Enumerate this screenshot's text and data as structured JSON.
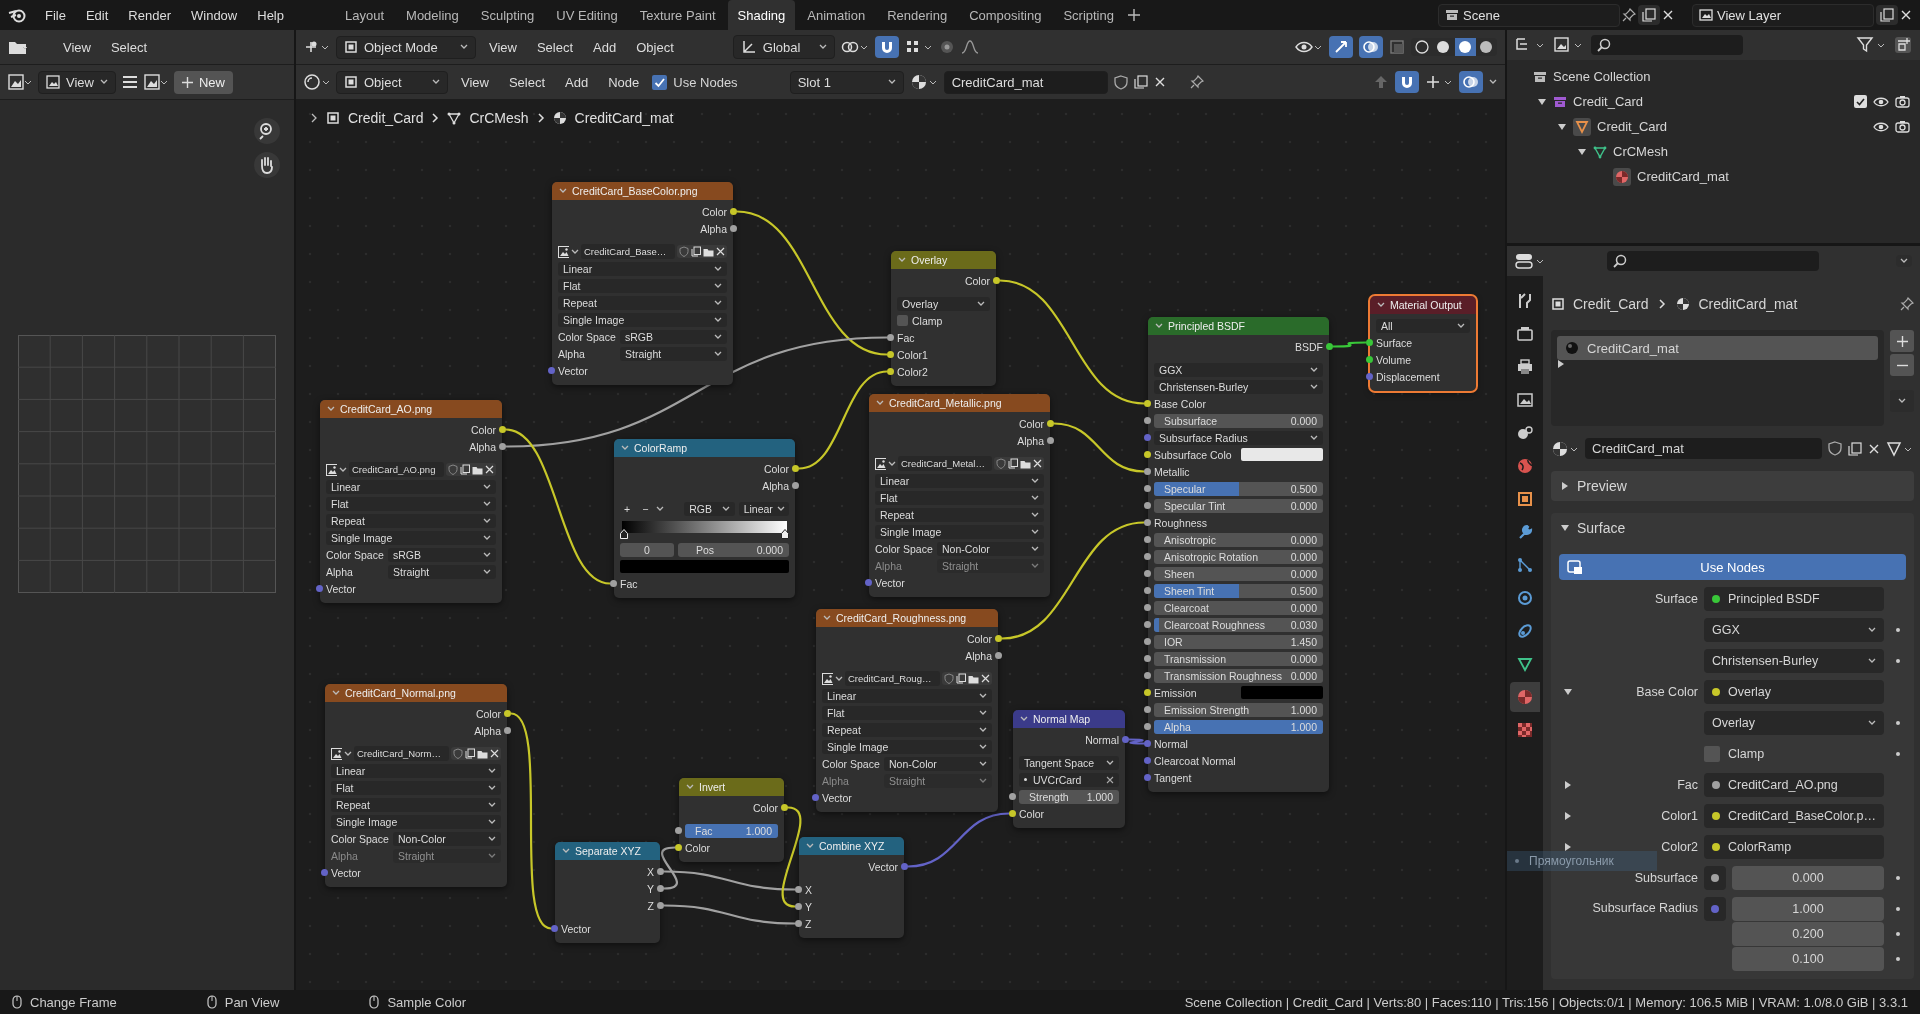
{
  "menu": [
    "File",
    "Edit",
    "Render",
    "Window",
    "Help"
  ],
  "workspaces": [
    {
      "label": "Layout",
      "selected": false
    },
    {
      "label": "Modeling",
      "selected": false
    },
    {
      "label": "Sculpting",
      "selected": false
    },
    {
      "label": "UV Editing",
      "selected": false
    },
    {
      "label": "Texture Paint",
      "selected": false
    },
    {
      "label": "Shading",
      "selected": true
    },
    {
      "label": "Animation",
      "selected": false
    },
    {
      "label": "Rendering",
      "selected": false
    },
    {
      "label": "Compositing",
      "selected": false
    },
    {
      "label": "Scripting",
      "selected": false
    }
  ],
  "scene": "Scene",
  "view_layer": "View Layer",
  "file_browser_header": {
    "menus": [
      "View",
      "Select"
    ]
  },
  "image_editor_header": {
    "view": "View",
    "new_button": "New"
  },
  "viewport_header": {
    "mode": "Object Mode",
    "menus": [
      "View",
      "Select",
      "Add",
      "Object"
    ],
    "orientation": "Global"
  },
  "node_header": {
    "type": "Object",
    "menus": [
      "View",
      "Select",
      "Add",
      "Node"
    ],
    "use_nodes": {
      "label": "Use Nodes",
      "checked": true
    },
    "slot": "Slot 1",
    "material": "CreditCard_mat"
  },
  "breadcrumbs": [
    {
      "label": "Credit_Card",
      "kind": "object"
    },
    {
      "label": "CrCMesh",
      "kind": "mesh"
    },
    {
      "label": "CreditCard_mat",
      "kind": "material"
    }
  ],
  "nodes": [
    {
      "title": "CreditCard_BaseColor.png",
      "kind": "texture",
      "selected": false,
      "rows": [
        {
          "kind": "output",
          "label": "Color",
          "socket": {
            "kind": "color"
          }
        },
        {
          "kind": "output",
          "label": "Alpha",
          "socket": {
            "kind": "float"
          }
        },
        {
          "kind": "image",
          "value": "CreditCard_Base…"
        },
        {
          "kind": "select",
          "value": "Linear"
        },
        {
          "kind": "select",
          "value": "Flat"
        },
        {
          "kind": "select",
          "value": "Repeat"
        },
        {
          "kind": "select",
          "value": "Single Image"
        },
        {
          "kind": "field",
          "label": "Color Space",
          "value": "sRGB",
          "disabled": false
        },
        {
          "kind": "field",
          "label": "Alpha",
          "value": "Straight",
          "disabled": false
        },
        {
          "kind": "input",
          "label": "Vector",
          "socket": {
            "kind": "vector"
          }
        }
      ]
    },
    {
      "title": "Overlay",
      "kind": "color",
      "selected": false,
      "rows": [
        {
          "kind": "output",
          "label": "Color",
          "socket": {
            "kind": "color"
          }
        },
        {
          "kind": "select",
          "value": "Overlay"
        },
        {
          "kind": "checkbox",
          "label": "Clamp",
          "checked": false
        },
        {
          "kind": "input",
          "label": "Fac",
          "socket": {
            "kind": "float"
          }
        },
        {
          "kind": "input",
          "label": "Color1",
          "socket": {
            "kind": "color"
          }
        },
        {
          "kind": "input",
          "label": "Color2",
          "socket": {
            "kind": "color"
          }
        }
      ]
    },
    {
      "title": "Principled BSDF",
      "kind": "shader",
      "selected": false,
      "rows": [
        {
          "kind": "output",
          "label": "BSDF",
          "socket": {
            "kind": "shader"
          }
        },
        {
          "kind": "select",
          "value": "GGX"
        },
        {
          "kind": "select",
          "value": "Christensen-Burley"
        },
        {
          "kind": "input",
          "label": "Base Color",
          "socket": {
            "kind": "color"
          }
        },
        {
          "kind": "slider",
          "label": "Subsurface",
          "value": "0.000",
          "level": 0,
          "socket": {
            "kind": "float"
          }
        },
        {
          "kind": "select",
          "value": "Subsurface Radius",
          "socket": {
            "kind": "vector"
          }
        },
        {
          "kind": "color",
          "label": "Subsurface Colo",
          "color": "#e8e8e8",
          "socket": {
            "kind": "color"
          }
        },
        {
          "kind": "input",
          "label": "Metallic",
          "socket": {
            "kind": "float"
          }
        },
        {
          "kind": "slider",
          "label": "Specular",
          "value": "0.500",
          "level": 0.5,
          "socket": {
            "kind": "float"
          }
        },
        {
          "kind": "slider",
          "label": "Specular Tint",
          "value": "0.000",
          "level": 0,
          "socket": {
            "kind": "float"
          }
        },
        {
          "kind": "input",
          "label": "Roughness",
          "socket": {
            "kind": "float"
          }
        },
        {
          "kind": "slider",
          "label": "Anisotropic",
          "value": "0.000",
          "level": 0,
          "socket": {
            "kind": "float"
          }
        },
        {
          "kind": "slider",
          "label": "Anisotropic Rotation",
          "value": "0.000",
          "level": 0,
          "socket": {
            "kind": "float"
          }
        },
        {
          "kind": "slider",
          "label": "Sheen",
          "value": "0.000",
          "level": 0,
          "socket": {
            "kind": "float"
          }
        },
        {
          "kind": "slider",
          "label": "Sheen Tint",
          "value": "0.500",
          "level": 0.5,
          "socket": {
            "kind": "float"
          }
        },
        {
          "kind": "slider",
          "label": "Clearcoat",
          "value": "0.000",
          "level": 0,
          "socket": {
            "kind": "float"
          }
        },
        {
          "kind": "slider",
          "label": "Clearcoat Roughness",
          "value": "0.030",
          "level": 0.03,
          "socket": {
            "kind": "float"
          }
        },
        {
          "kind": "slider",
          "label": "IOR",
          "value": "1.450",
          "level": 0,
          "socket": {
            "kind": "float"
          }
        },
        {
          "kind": "slider",
          "label": "Transmission",
          "value": "0.000",
          "level": 0,
          "socket": {
            "kind": "float"
          }
        },
        {
          "kind": "slider",
          "label": "Transmission Roughness",
          "value": "0.000",
          "level": 0,
          "socket": {
            "kind": "float"
          }
        },
        {
          "kind": "color",
          "label": "Emission",
          "color": "#000000",
          "socket": {
            "kind": "color"
          }
        },
        {
          "kind": "slider",
          "label": "Emission Strength",
          "value": "1.000",
          "level": 0,
          "socket": {
            "kind": "float"
          }
        },
        {
          "kind": "slider",
          "label": "Alpha",
          "value": "1.000",
          "level": 1,
          "socket": {
            "kind": "float"
          }
        },
        {
          "kind": "input",
          "label": "Normal",
          "socket": {
            "kind": "vector"
          }
        },
        {
          "kind": "input",
          "label": "Clearcoat Normal",
          "socket": {
            "kind": "vector"
          }
        },
        {
          "kind": "input",
          "label": "Tangent",
          "socket": {
            "kind": "vector"
          }
        }
      ]
    },
    {
      "title": "Material Output",
      "kind": "output",
      "selected": true,
      "rows": [
        {
          "kind": "select",
          "value": "All"
        },
        {
          "kind": "input",
          "label": "Surface",
          "socket": {
            "kind": "shader"
          }
        },
        {
          "kind": "input",
          "label": "Volume",
          "socket": {
            "kind": "shader"
          }
        },
        {
          "kind": "input",
          "label": "Displacement",
          "socket": {
            "kind": "vector"
          }
        }
      ]
    },
    {
      "title": "CreditCard_AO.png",
      "kind": "texture",
      "selected": false,
      "rows": [
        {
          "kind": "output",
          "label": "Color",
          "socket": {
            "kind": "color"
          }
        },
        {
          "kind": "output",
          "label": "Alpha",
          "socket": {
            "kind": "float"
          }
        },
        {
          "kind": "image",
          "value": "CreditCard_AO.png"
        },
        {
          "kind": "select",
          "value": "Linear"
        },
        {
          "kind": "select",
          "value": "Flat"
        },
        {
          "kind": "select",
          "value": "Repeat"
        },
        {
          "kind": "select",
          "value": "Single Image"
        },
        {
          "kind": "field",
          "label": "Color Space",
          "value": "sRGB",
          "disabled": false
        },
        {
          "kind": "field",
          "label": "Alpha",
          "value": "Straight",
          "disabled": false
        },
        {
          "kind": "input",
          "label": "Vector",
          "socket": {
            "kind": "vector"
          }
        }
      ]
    },
    {
      "title": "ColorRamp",
      "kind": "converter",
      "selected": false,
      "rows": [
        {
          "kind": "output",
          "label": "Color",
          "socket": {
            "kind": "color"
          }
        },
        {
          "kind": "output",
          "label": "Alpha",
          "socket": {
            "kind": "float"
          }
        },
        {
          "kind": "ramp_tools",
          "add": "+",
          "remove": "−",
          "mode": "RGB",
          "interpolation": "Linear"
        },
        {
          "kind": "ramp_bar"
        },
        {
          "kind": "ramp_stop",
          "index": "0",
          "label": "Pos",
          "value": "0.000"
        },
        {
          "kind": "color",
          "color": "#000000"
        },
        {
          "kind": "input",
          "label": "Fac",
          "socket": {
            "kind": "float"
          }
        }
      ]
    },
    {
      "title": "CreditCard_Metallic.png",
      "kind": "texture",
      "selected": false,
      "rows": [
        {
          "kind": "output",
          "label": "Color",
          "socket": {
            "kind": "color"
          }
        },
        {
          "kind": "output",
          "label": "Alpha",
          "socket": {
            "kind": "float"
          }
        },
        {
          "kind": "image",
          "value": "CreditCard_Metal…"
        },
        {
          "kind": "select",
          "value": "Linear"
        },
        {
          "kind": "select",
          "value": "Flat"
        },
        {
          "kind": "select",
          "value": "Repeat"
        },
        {
          "kind": "select",
          "value": "Single Image"
        },
        {
          "kind": "field",
          "label": "Color Space",
          "value": "Non-Color",
          "disabled": false
        },
        {
          "kind": "field",
          "label": "Alpha",
          "value": "Straight",
          "disabled": true
        },
        {
          "kind": "input",
          "label": "Vector",
          "socket": {
            "kind": "vector"
          }
        }
      ]
    },
    {
      "title": "CreditCard_Normal.png",
      "kind": "texture",
      "selected": false,
      "rows": [
        {
          "kind": "output",
          "label": "Color",
          "socket": {
            "kind": "color"
          }
        },
        {
          "kind": "output",
          "label": "Alpha",
          "socket": {
            "kind": "float"
          }
        },
        {
          "kind": "image",
          "value": "CreditCard_Norm…"
        },
        {
          "kind": "select",
          "value": "Linear"
        },
        {
          "kind": "select",
          "value": "Flat"
        },
        {
          "kind": "select",
          "value": "Repeat"
        },
        {
          "kind": "select",
          "value": "Single Image"
        },
        {
          "kind": "field",
          "label": "Color Space",
          "value": "Non-Color",
          "disabled": false
        },
        {
          "kind": "field",
          "label": "Alpha",
          "value": "Straight",
          "disabled": true
        },
        {
          "kind": "input",
          "label": "Vector",
          "socket": {
            "kind": "vector"
          }
        }
      ]
    },
    {
      "title": "Separate XYZ",
      "kind": "converter",
      "selected": false,
      "rows": [
        {
          "kind": "output",
          "label": "X",
          "socket": {
            "kind": "float"
          }
        },
        {
          "kind": "output",
          "label": "Y",
          "socket": {
            "kind": "float"
          }
        },
        {
          "kind": "output",
          "label": "Z",
          "socket": {
            "kind": "float"
          }
        },
        {
          "kind": "input",
          "label": "Vector",
          "socket": {
            "kind": "vector"
          }
        }
      ]
    },
    {
      "title": "Invert",
      "kind": "color",
      "selected": false,
      "rows": [
        {
          "kind": "output",
          "label": "Color",
          "socket": {
            "kind": "color"
          }
        },
        {
          "kind": "slider",
          "label": "Fac",
          "value": "1.000",
          "level": 1,
          "socket": {
            "kind": "float"
          }
        },
        {
          "kind": "input",
          "label": "Color",
          "socket": {
            "kind": "color"
          }
        }
      ]
    },
    {
      "title": "CreditCard_Roughness.png",
      "kind": "texture",
      "selected": false,
      "rows": [
        {
          "kind": "output",
          "label": "Color",
          "socket": {
            "kind": "color"
          }
        },
        {
          "kind": "output",
          "label": "Alpha",
          "socket": {
            "kind": "float"
          }
        },
        {
          "kind": "image",
          "value": "CreditCard_Roug…"
        },
        {
          "kind": "select",
          "value": "Linear"
        },
        {
          "kind": "select",
          "value": "Flat"
        },
        {
          "kind": "select",
          "value": "Repeat"
        },
        {
          "kind": "select",
          "value": "Single Image"
        },
        {
          "kind": "field",
          "label": "Color Space",
          "value": "Non-Color",
          "disabled": false
        },
        {
          "kind": "field",
          "label": "Alpha",
          "value": "Straight",
          "disabled": true
        },
        {
          "kind": "input",
          "label": "Vector",
          "socket": {
            "kind": "vector"
          }
        }
      ]
    },
    {
      "title": "Combine XYZ",
      "kind": "converter",
      "selected": false,
      "rows": [
        {
          "kind": "output",
          "label": "Vector",
          "socket": {
            "kind": "vector"
          }
        },
        {
          "kind": "input",
          "label": "X",
          "socket": {
            "kind": "float"
          }
        },
        {
          "kind": "input",
          "label": "Y",
          "socket": {
            "kind": "float"
          }
        },
        {
          "kind": "input",
          "label": "Z",
          "socket": {
            "kind": "float"
          }
        }
      ]
    },
    {
      "title": "Normal Map",
      "kind": "vector",
      "selected": false,
      "rows": [
        {
          "kind": "output",
          "label": "Normal",
          "socket": {
            "kind": "vector"
          }
        },
        {
          "kind": "select",
          "value": "Tangent Space"
        },
        {
          "kind": "uv_map",
          "value": "UVCrCard"
        },
        {
          "kind": "slider",
          "label": "Strength",
          "value": "1.000",
          "level": 0,
          "socket": {
            "kind": "float"
          }
        },
        {
          "kind": "input",
          "label": "Color",
          "socket": {
            "kind": "color"
          }
        }
      ]
    }
  ],
  "outliner": {
    "items": [
      {
        "label": "Scene Collection",
        "kind": "scene",
        "children": [
          {
            "label": "Credit_Card",
            "kind": "collection",
            "checked": true,
            "expanded": true,
            "children": [
              {
                "label": "Credit_Card",
                "kind": "object",
                "expanded": true,
                "children": [
                  {
                    "label": "CrCMesh",
                    "kind": "mesh",
                    "expanded": true,
                    "children": [
                      {
                        "label": "CreditCard_mat",
                        "kind": "material"
                      }
                    ]
                  }
                ]
              }
            ]
          }
        ]
      }
    ]
  },
  "properties": {
    "tabs": [
      {
        "kind": "tool",
        "selected": false
      },
      {
        "kind": "render",
        "selected": false
      },
      {
        "kind": "output",
        "selected": false
      },
      {
        "kind": "view_layer",
        "selected": false
      },
      {
        "kind": "scene",
        "selected": false
      },
      {
        "kind": "world",
        "selected": false
      },
      {
        "kind": "object",
        "selected": false
      },
      {
        "kind": "modifier",
        "selected": false
      },
      {
        "kind": "particles",
        "selected": false
      },
      {
        "kind": "physics",
        "selected": false
      },
      {
        "kind": "constraints",
        "selected": false
      },
      {
        "kind": "data",
        "selected": false
      },
      {
        "kind": "material",
        "selected": true
      },
      {
        "kind": "texture",
        "selected": false
      }
    ],
    "breadcrumb": [
      {
        "label": "Credit_Card",
        "kind": "object"
      },
      {
        "label": "CreditCard_mat",
        "kind": "material"
      }
    ],
    "slots": [
      {
        "label": "CreditCard_mat",
        "selected": true
      }
    ],
    "material_field": "CreditCard_mat",
    "preview_panel": {
      "label": "Preview",
      "expanded": false
    },
    "surface_panel": {
      "label": "Surface",
      "expanded": true,
      "use_nodes": "Use Nodes",
      "rows": [
        {
          "kind": "link",
          "label": "Surface",
          "value": "Principled BSDF",
          "socket": {
            "kind": "shader"
          }
        },
        {
          "kind": "select",
          "value": "GGX"
        },
        {
          "kind": "select",
          "value": "Christensen-Burley"
        },
        {
          "kind": "link",
          "label": "Base Color",
          "value": "Overlay",
          "socket": {
            "kind": "color"
          },
          "expanded": true
        },
        {
          "kind": "select",
          "value": "Overlay"
        },
        {
          "kind": "checkbox",
          "label": "Clamp",
          "checked": false
        },
        {
          "kind": "link",
          "label": "Fac",
          "value": "CreditCard_AO.png",
          "socket": {
            "kind": "float"
          },
          "expanded": false
        },
        {
          "kind": "link",
          "label": "Color1",
          "value": "CreditCard_BaseColor.p…",
          "socket": {
            "kind": "color"
          },
          "expanded": false
        },
        {
          "kind": "link",
          "label": "Color2",
          "value": "ColorRamp",
          "socket": {
            "kind": "color"
          },
          "expanded": false
        },
        {
          "kind": "number",
          "label": "Subsurface",
          "value": "0.000",
          "socket": {
            "kind": "float"
          }
        },
        {
          "kind": "vector",
          "label": "Subsurface Radius",
          "values": [
            "1.000",
            "0.200",
            "0.100"
          ],
          "socket": {
            "kind": "vector"
          }
        }
      ]
    }
  },
  "hint_overlay": "Прямоугольник",
  "status_bar": {
    "actions": [
      "Change Frame",
      "Pan View",
      "Sample Color"
    ],
    "stats": "Scene Collection | Credit_Card | Verts:80 | Faces:110 | Tris:156 | Objects:0/1 | Memory: 106.5 MiB | VRAM: 1.0/8.0 GiB | 3.3.1"
  }
}
